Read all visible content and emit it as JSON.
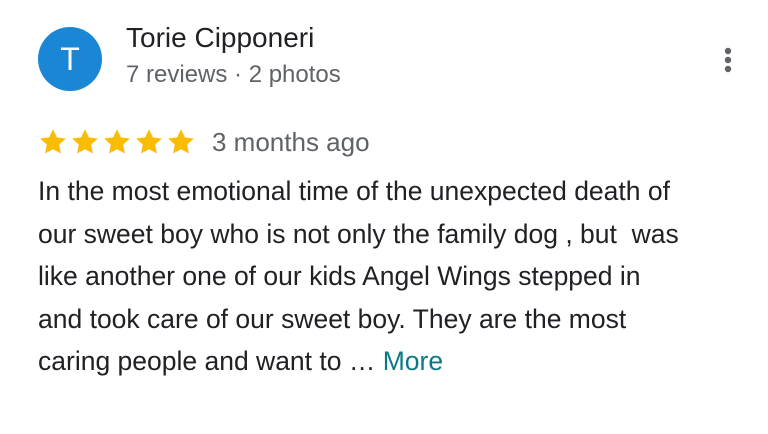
{
  "colors": {
    "avatar_bg": "#1a86d6",
    "star": "#fbbc04",
    "link": "#0b7a83"
  },
  "author": {
    "initial": "T",
    "name": "Torie Cipponeri",
    "meta": "7 reviews · 2 photos"
  },
  "menu": {
    "icon": "more-vert-icon"
  },
  "review": {
    "rating": 5,
    "rating_max": 5,
    "date": "3 months ago",
    "lines": [
      "In the most emotional time of the unexpected death of",
      "our sweet boy who is not only the family dog , but  was",
      "like another one of our kids Angel Wings stepped in",
      "and took care of our sweet boy. They are the most",
      "caring people and want to … "
    ],
    "more_label": "More"
  }
}
